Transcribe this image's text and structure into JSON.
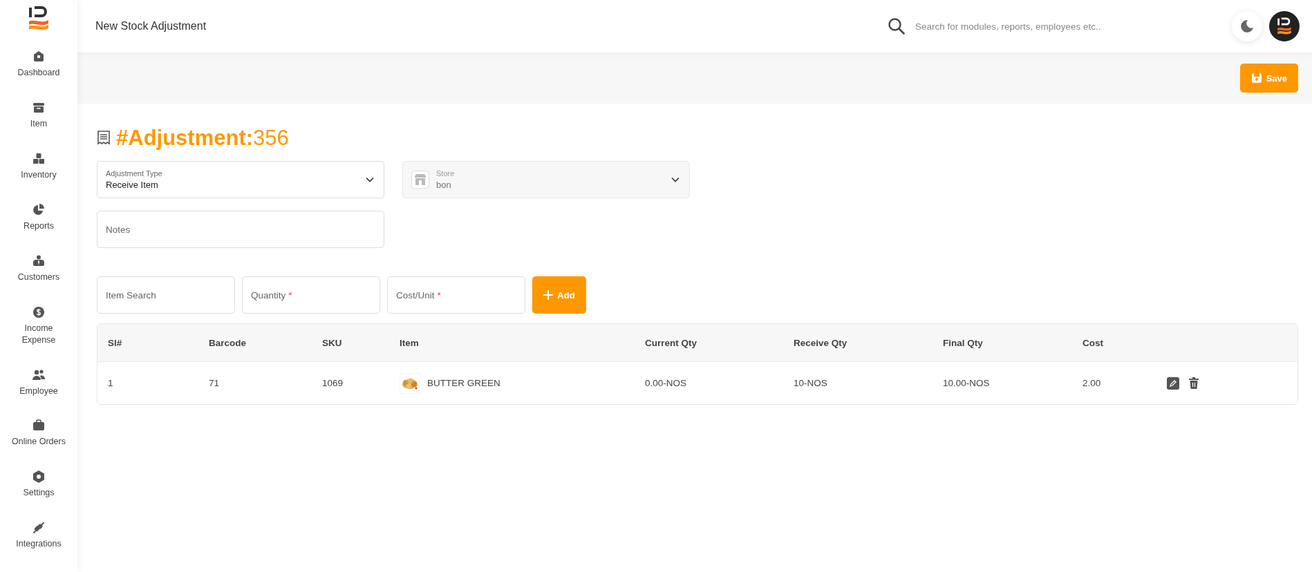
{
  "sidebar": {
    "items": [
      {
        "label": "Dashboard",
        "kind": "dashboard"
      },
      {
        "label": "Item",
        "kind": "item"
      },
      {
        "label": "Inventory",
        "kind": "inventory"
      },
      {
        "label": "Reports",
        "kind": "reports"
      },
      {
        "label": "Customers",
        "kind": "customers"
      },
      {
        "label": "Income Expense",
        "kind": "income"
      },
      {
        "label": "Employee",
        "kind": "employee"
      },
      {
        "label": "Online Orders",
        "kind": "orders"
      },
      {
        "label": "Settings",
        "kind": "settings"
      },
      {
        "label": "Integrations",
        "kind": "integrations"
      }
    ]
  },
  "header": {
    "title": "New Stock Adjustment",
    "search": {
      "placeholder": "Search for modules, reports, employees etc.."
    }
  },
  "toolbar": {
    "save_button": "Save"
  },
  "heading": "**#Adjustment:**356",
  "form": {
    "adjustment_type": {
      "label": "Adjustment Type",
      "value": "Receive Item"
    },
    "store": {
      "label": "Store",
      "value": "bon",
      "disabled": true
    },
    "notes": {
      "placeholder": "Notes"
    }
  },
  "entry": {
    "fields": [
      {
        "placeholder": "Item Search"
      },
      {
        "placeholder": "Quantity",
        "required_mark": "*"
      },
      {
        "placeholder": "Cost/Unit",
        "required_mark": "*"
      }
    ],
    "add_button": "Add"
  },
  "table": {
    "columns": [
      "Sl#",
      "Barcode",
      "SKU",
      "Item",
      "Current Qty",
      "Receive Qty",
      "Final Qty",
      "Cost"
    ],
    "rows": [
      {
        "cells": [
          "1",
          "71",
          "1069",
          "BUTTER GREEN",
          "0.00-NOS",
          "10-NOS",
          "10.00-NOS",
          "2.00"
        ]
      }
    ]
  }
}
